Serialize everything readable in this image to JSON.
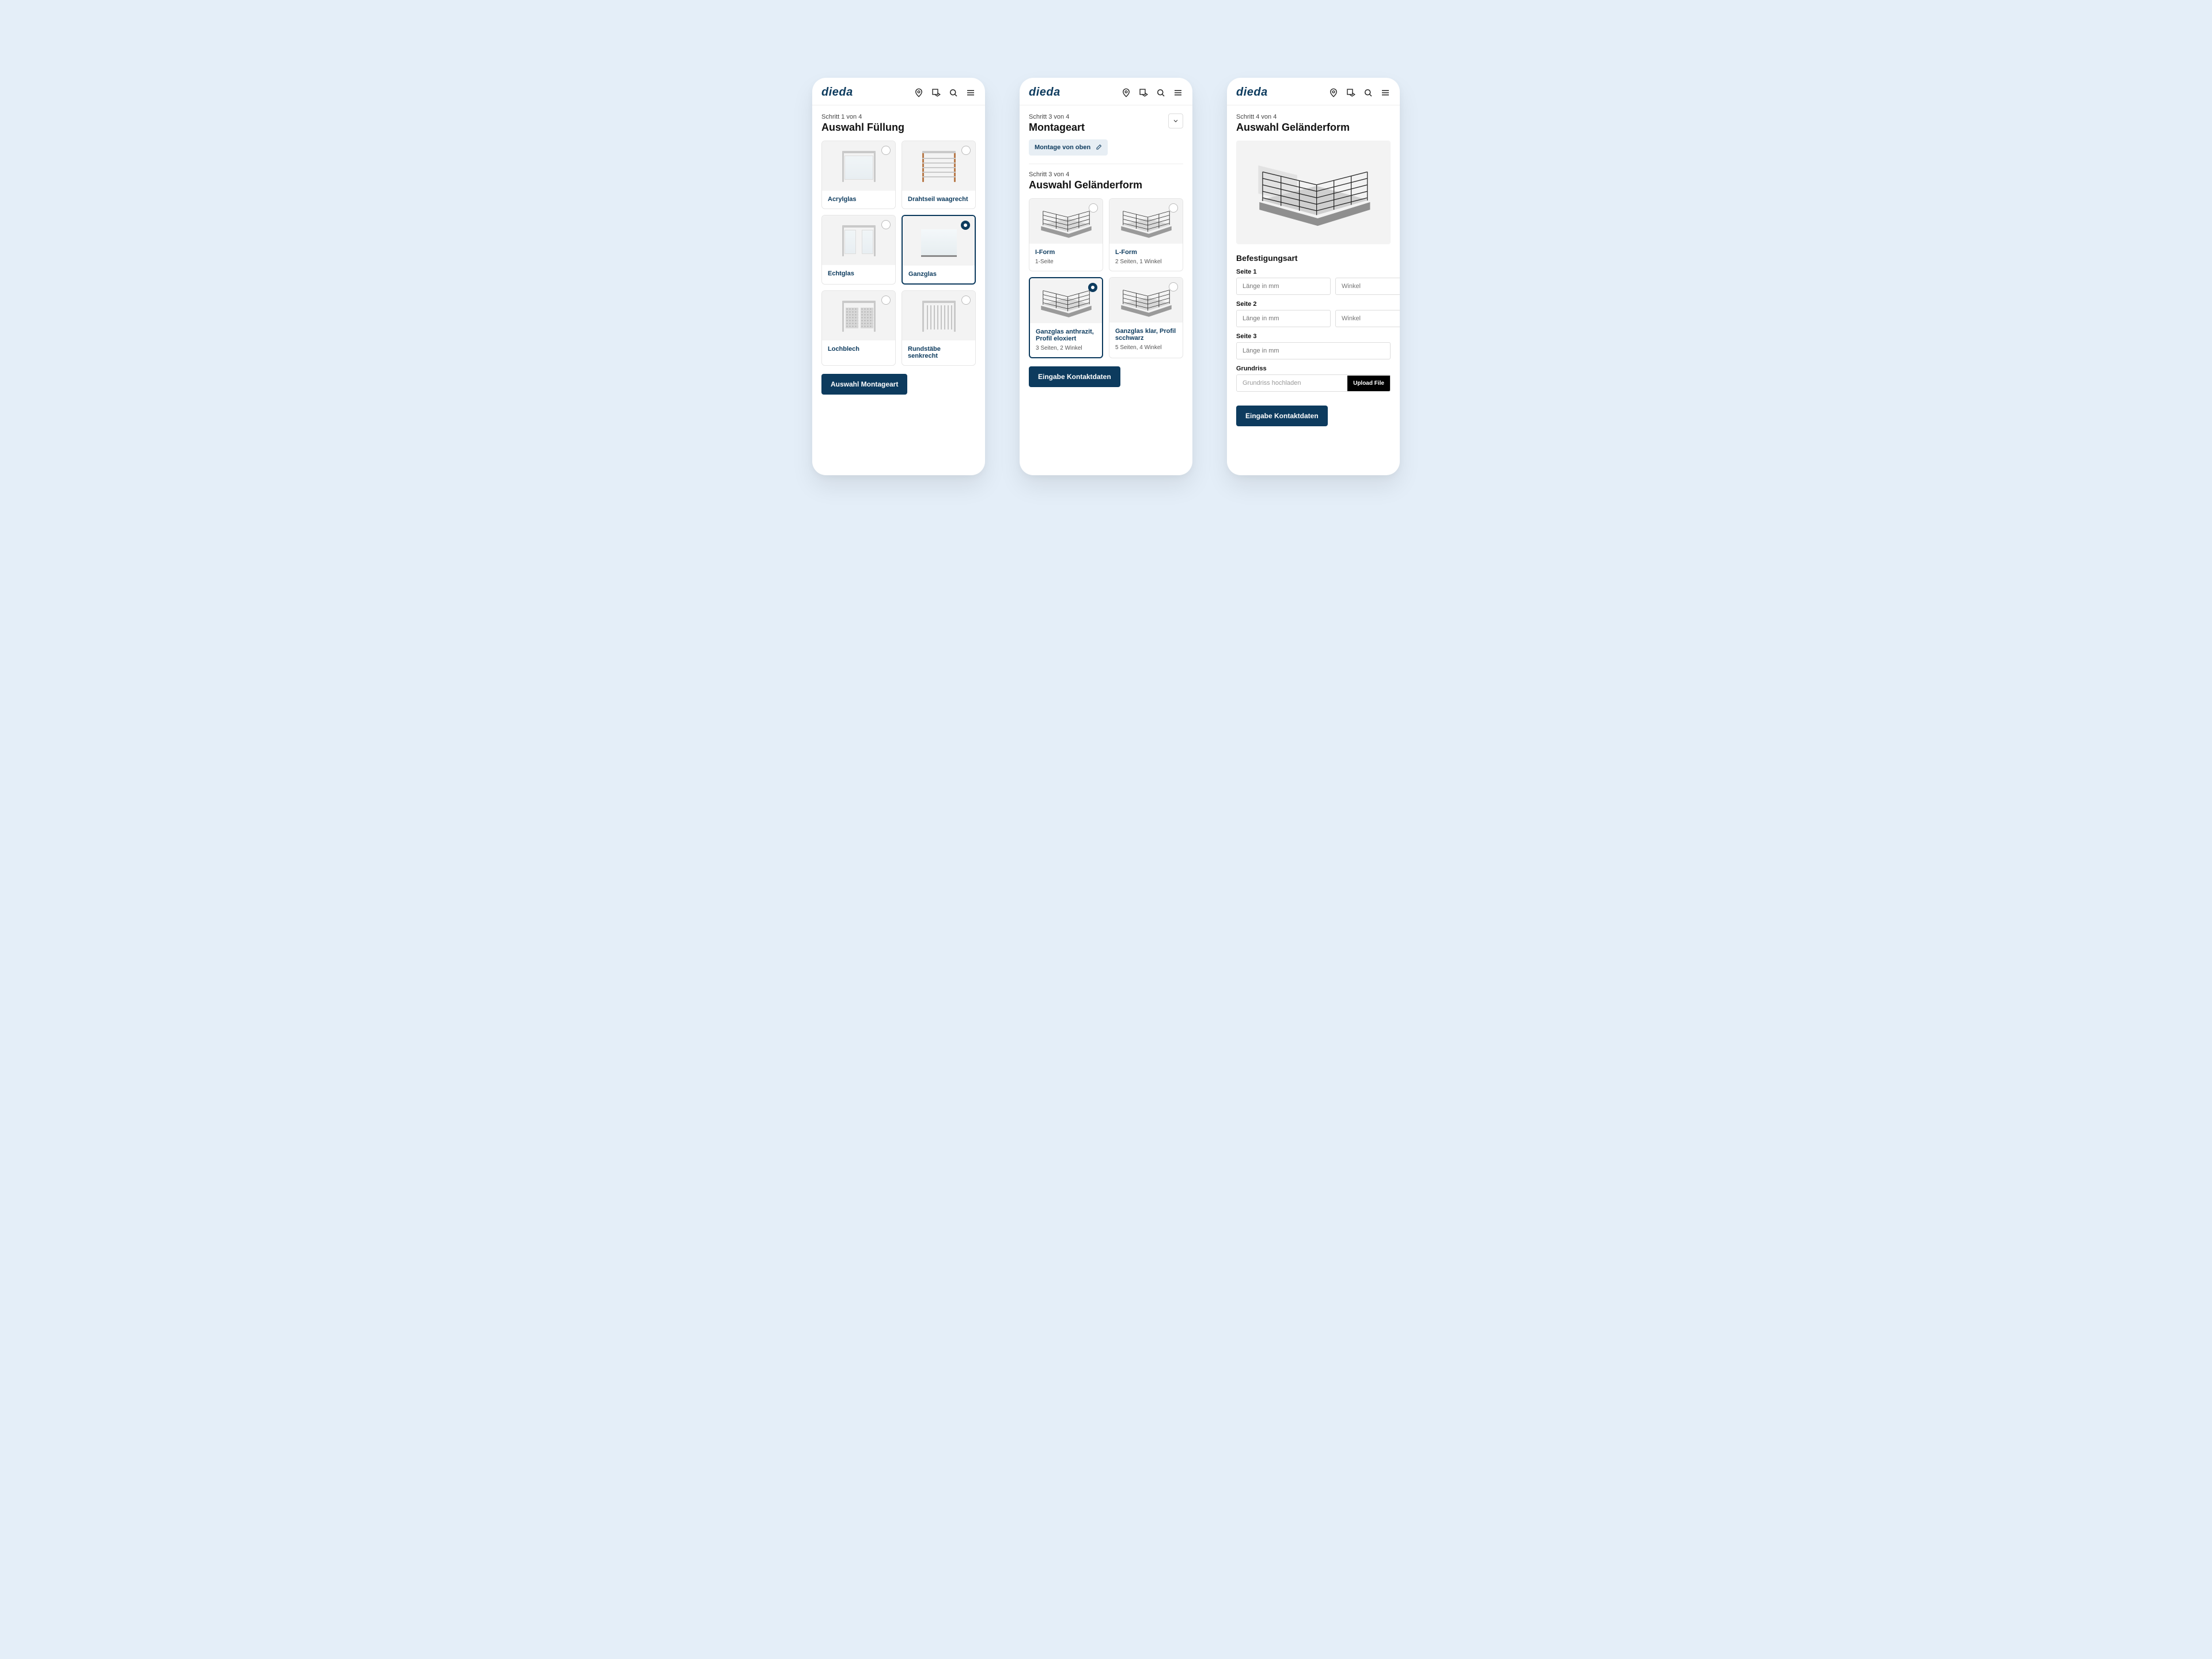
{
  "brand": "dieda",
  "screens": {
    "s1": {
      "step": "Schritt 1 von 4",
      "title": "Auswahl Füllung",
      "options": [
        {
          "label": "Acrylglas"
        },
        {
          "label": "Drahtseil waagrecht"
        },
        {
          "label": "Echtglas"
        },
        {
          "label": "Ganzglas"
        },
        {
          "label": "Lochblech"
        },
        {
          "label": "Rundstäbe senkrecht"
        }
      ],
      "cta": "Auswahl Montageart"
    },
    "s2": {
      "step_top": "Schritt 3 von 4",
      "title_top": "Montageart",
      "chip": "Montage von oben",
      "step_bottom": "Schritt 3 von 4",
      "title_bottom": "Auswahl Geländerform",
      "options": [
        {
          "label": "I-Form",
          "sub": "1-Seite"
        },
        {
          "label": "L-Form",
          "sub": "2 Seiten, 1 Winkel"
        },
        {
          "label": "Ganzglas anthrazit, Profil eloxiert",
          "sub": "3 Seiten, 2 Winkel"
        },
        {
          "label": "Ganzglas klar, Profil scchwarz",
          "sub": "5 Seiten, 4 Winkel"
        }
      ],
      "cta": "Eingabe Kontaktdaten"
    },
    "s3": {
      "step": "Schritt 4 von 4",
      "title": "Auswahl Geländerform",
      "section": "Befestigungsart",
      "sides": [
        {
          "label": "Seite 1",
          "len": "Länge in mm",
          "ang": "Winkel"
        },
        {
          "label": "Seite 2",
          "len": "Länge in mm",
          "ang": "Winkel"
        },
        {
          "label": "Seite 3",
          "len": "Länge in mm"
        }
      ],
      "grundriss_label": "Grundriss",
      "grundriss_placeholder": "Grundriss hochladen",
      "upload": "Upload File",
      "cta": "Eingabe Kontaktdaten"
    }
  }
}
